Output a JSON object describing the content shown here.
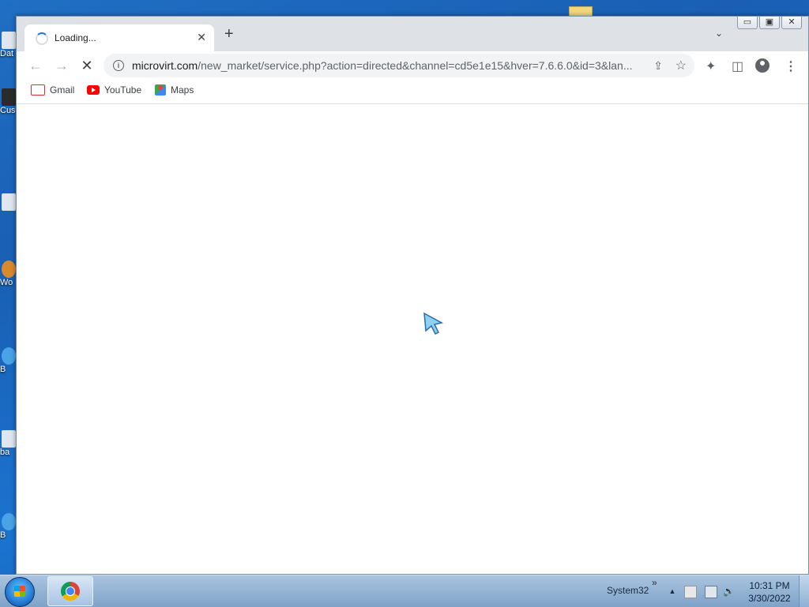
{
  "desktop": {
    "icon_labels": [
      "Dat",
      "Cus",
      "",
      "Wo",
      "B",
      "ba",
      "B"
    ]
  },
  "browser": {
    "tab": {
      "title": "Loading...",
      "close": "✕"
    },
    "new_tab": "+",
    "tab_search": "⌄",
    "window_controls": {
      "minimize": "▭",
      "maximize": "▣",
      "close": "✕"
    },
    "toolbar": {
      "back": "←",
      "forward": "→",
      "stop": "✕",
      "url_host": "microvirt.com",
      "url_path": "/new_market/service.php?action=directed&channel=cd5e1e15&hver=7.6.6.0&id=3&lan...",
      "info": "i",
      "share": "⇪",
      "bookmark_star": "☆",
      "extensions": "✦",
      "side_panel": "◫",
      "menu": "⋮"
    },
    "bookmarks": [
      {
        "label": "Gmail"
      },
      {
        "label": "YouTube"
      },
      {
        "label": "Maps"
      }
    ]
  },
  "taskbar": {
    "toolbar_label": "System32",
    "chevron": "»",
    "tray_arrow": "▲",
    "time": "10:31 PM",
    "date": "3/30/2022"
  }
}
